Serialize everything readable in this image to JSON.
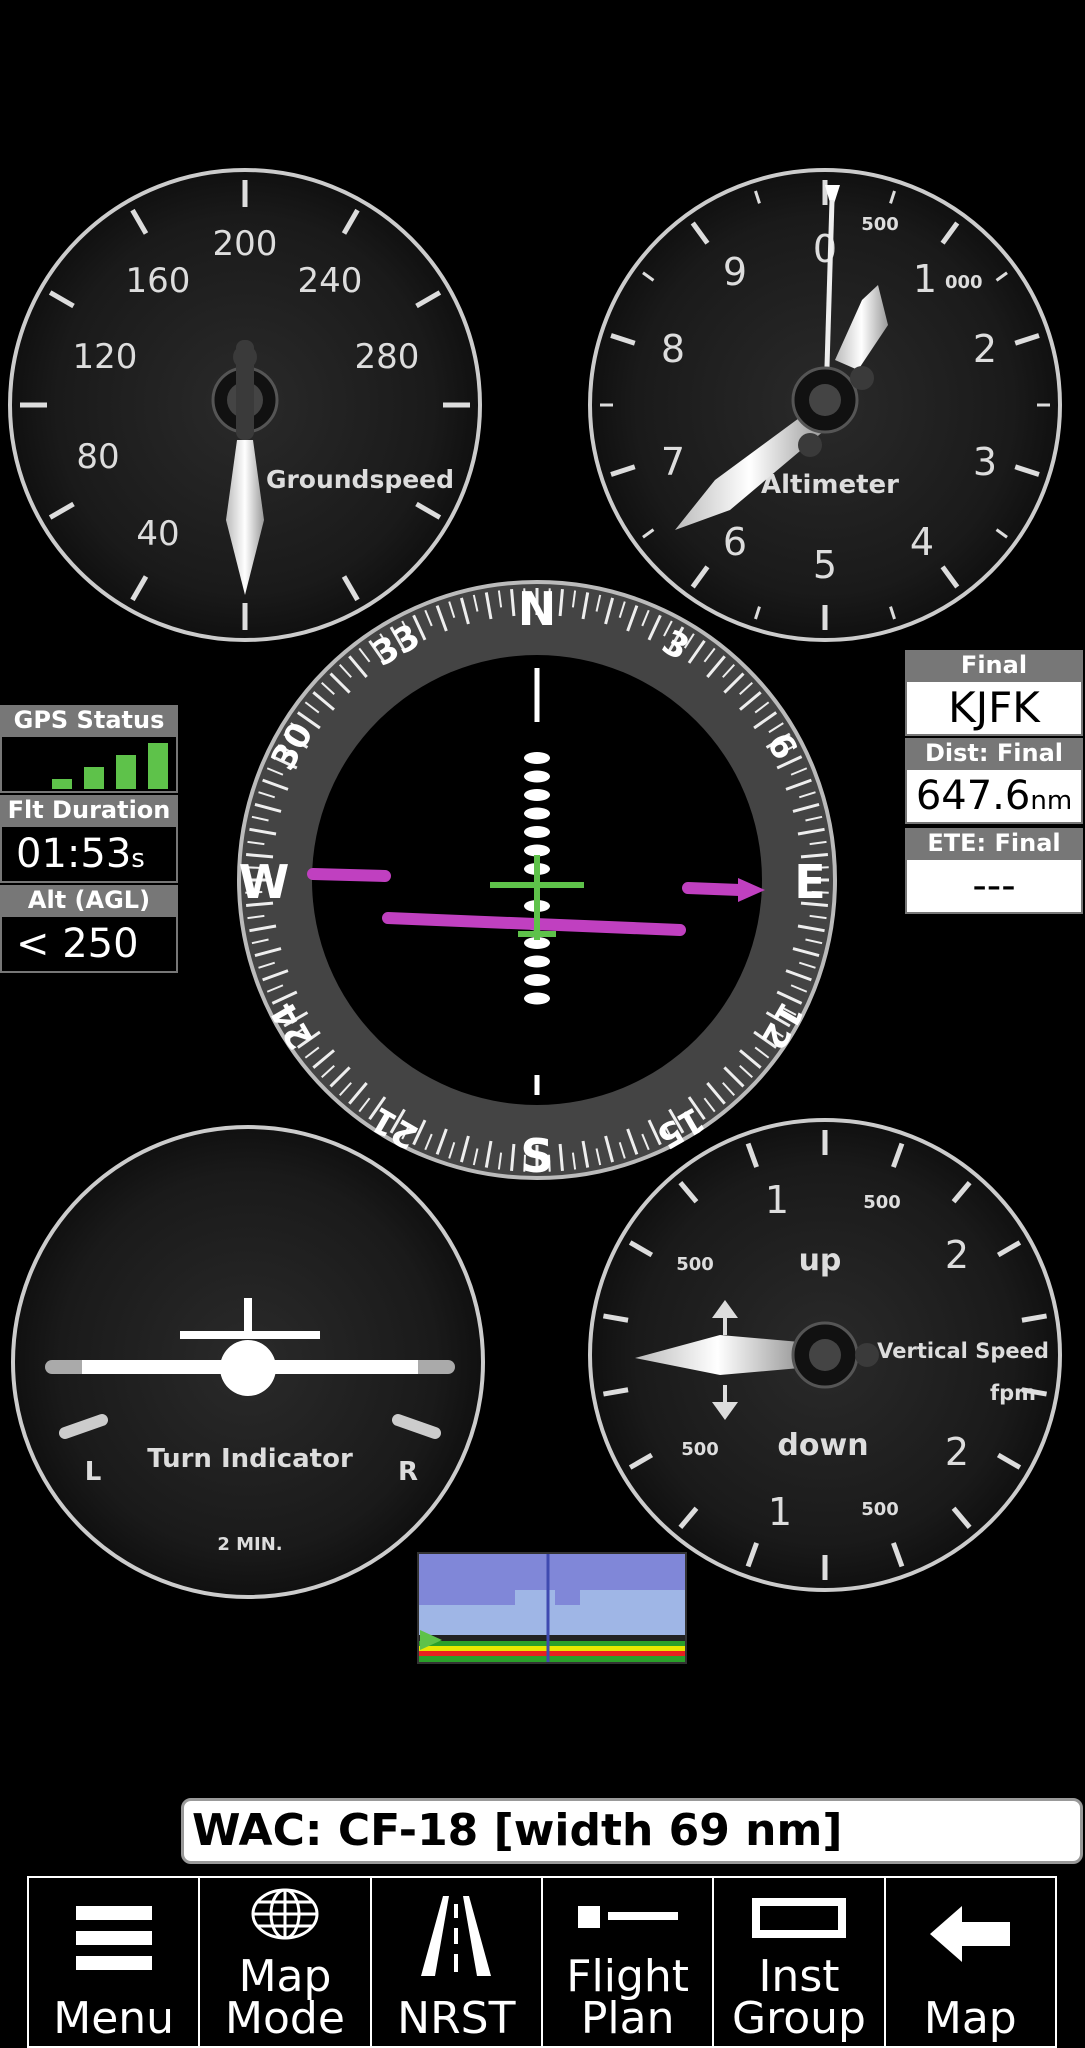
{
  "gauges": {
    "groundspeed": {
      "label": "Groundspeed",
      "ticks": [
        "40",
        "80",
        "120",
        "160",
        "200",
        "240",
        "280"
      ]
    },
    "altimeter": {
      "label": "Altimeter",
      "numbers": [
        "0",
        "1",
        "2",
        "3",
        "4",
        "5",
        "6",
        "7",
        "8",
        "9"
      ],
      "sub_500": "500",
      "sub_1000": "000"
    },
    "heading": {
      "cardinals": [
        "N",
        "E",
        "S",
        "W"
      ],
      "numbers": [
        "3",
        "6",
        "12",
        "15",
        "21",
        "24",
        "30",
        "33"
      ]
    },
    "turn": {
      "label": "Turn Indicator",
      "left": "L",
      "right": "R",
      "time": "2 MIN."
    },
    "vsi": {
      "label": "Vertical Speed",
      "unit": "fpm",
      "up": "up",
      "down": "down",
      "n1": "1",
      "n2": "2",
      "n500": "500"
    }
  },
  "left_panel": {
    "gps_status_label": "GPS Status",
    "flt_duration_label": "Flt Duration",
    "flt_duration_value": "01:53",
    "flt_duration_unit": "s",
    "alt_label": "Alt (AGL)",
    "alt_value": "< 250"
  },
  "right_panel": {
    "final_label": "Final",
    "final_value": "KJFK",
    "dist_label": "Dist: Final",
    "dist_value": "647.6",
    "dist_unit": "nm",
    "ete_label": "ETE: Final",
    "ete_value": "---"
  },
  "status_bar": {
    "text": "WAC: CF-18 [width 69 nm]"
  },
  "toolbar": {
    "menu": "Menu",
    "map_mode_1": "Map",
    "map_mode_2": "Mode",
    "nrst": "NRST",
    "flight_plan_1": "Flight",
    "flight_plan_2": "Plan",
    "inst_group_1": "Inst",
    "inst_group_2": "Group",
    "map": "Map"
  },
  "colors": {
    "accent_green": "#5ec24a",
    "magenta": "#c040c0",
    "panel_gray": "#777777"
  }
}
